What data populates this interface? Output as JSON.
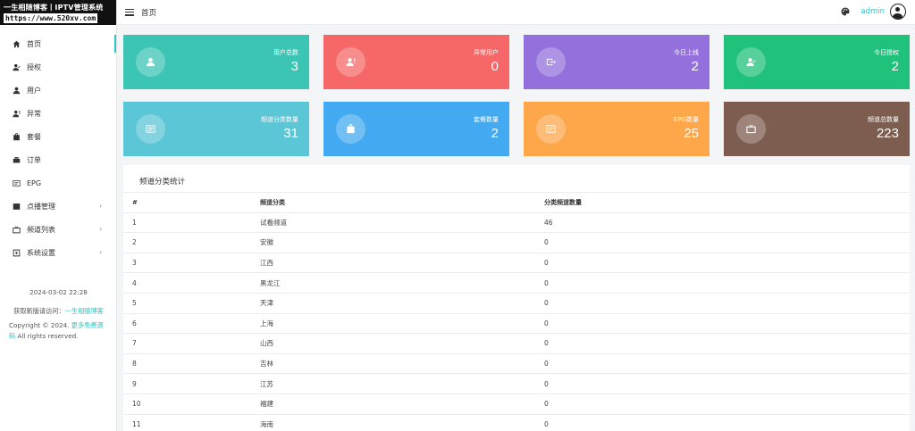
{
  "logo": {
    "line1": "一生相随博客丨IPTV管理系统",
    "line2": "https://www.520xv.com"
  },
  "topbar": {
    "breadcrumb": "首页",
    "username": "admin"
  },
  "sidebar": {
    "items": [
      {
        "label": "首页",
        "icon": "home-icon",
        "active": true,
        "submenu": false
      },
      {
        "label": "授权",
        "icon": "user-check-icon",
        "active": false,
        "submenu": false
      },
      {
        "label": "用户",
        "icon": "user-icon",
        "active": false,
        "submenu": false
      },
      {
        "label": "异常",
        "icon": "user-alert-icon",
        "active": false,
        "submenu": false
      },
      {
        "label": "套餐",
        "icon": "bag-icon",
        "active": false,
        "submenu": false
      },
      {
        "label": "订单",
        "icon": "cart-icon",
        "active": false,
        "submenu": false
      },
      {
        "label": "EPG",
        "icon": "epg-icon",
        "active": false,
        "submenu": false
      },
      {
        "label": "点播管理",
        "icon": "image-icon",
        "active": false,
        "submenu": true
      },
      {
        "label": "频道列表",
        "icon": "tv-icon",
        "active": false,
        "submenu": true
      },
      {
        "label": "系统设置",
        "icon": "settings-icon",
        "active": false,
        "submenu": true
      }
    ],
    "footer": {
      "datetime": "2024-03-02 22:28",
      "tip_prefix": "获取新版请访问：",
      "tip_link": "一生相随博客",
      "copyright_prefix": "Copyright © 2024. ",
      "copyright_link": "更多免费源码",
      "copyright_suffix": " All rights reserved."
    }
  },
  "cards": [
    {
      "label": "用户总数",
      "value": "3",
      "color": "#3cc4b4",
      "icon": "user-icon"
    },
    {
      "label": "异常用户",
      "value": "0",
      "color": "#f56867",
      "icon": "user-alert-icon"
    },
    {
      "label": "今日上线",
      "value": "2",
      "color": "#9370db",
      "icon": "login-icon"
    },
    {
      "label": "今日授权",
      "value": "2",
      "color": "#1fc17b",
      "icon": "user-check-icon"
    },
    {
      "label": "频道分类数量",
      "value": "31",
      "color": "#5ac6d6",
      "icon": "list-icon"
    },
    {
      "label": "套餐数量",
      "value": "2",
      "color": "#43aaf1",
      "icon": "bag-icon"
    },
    {
      "label": "EPG数量",
      "value": "25",
      "color": "#fda64a",
      "icon": "epg-icon"
    },
    {
      "label": "频道总数量",
      "value": "223",
      "color": "#7d5d4f",
      "icon": "tv-icon"
    }
  ],
  "table": {
    "title": "频道分类统计",
    "columns": [
      "#",
      "频道分类",
      "分类频道数量"
    ],
    "rows": [
      [
        "1",
        "试看频道",
        "46"
      ],
      [
        "2",
        "安徽",
        "0"
      ],
      [
        "3",
        "江西",
        "0"
      ],
      [
        "4",
        "黑龙江",
        "0"
      ],
      [
        "5",
        "天津",
        "0"
      ],
      [
        "6",
        "上海",
        "0"
      ],
      [
        "7",
        "山西",
        "0"
      ],
      [
        "8",
        "吉林",
        "0"
      ],
      [
        "9",
        "江苏",
        "0"
      ],
      [
        "10",
        "福建",
        "0"
      ],
      [
        "11",
        "海南",
        "0"
      ]
    ]
  }
}
